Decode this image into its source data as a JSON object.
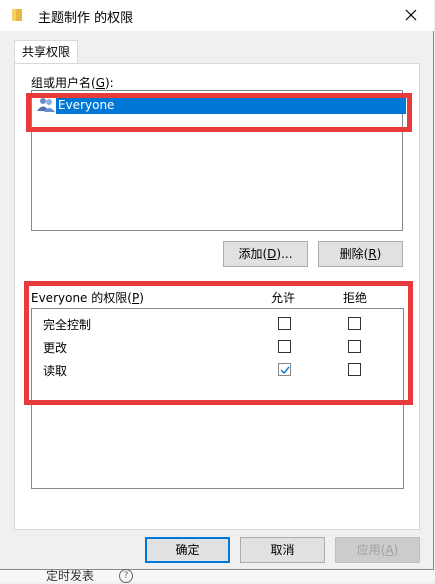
{
  "window": {
    "title": "主题制作 的权限",
    "close_icon": "close-icon",
    "folder_icon": "folder-icon"
  },
  "tab": {
    "label": "共享权限"
  },
  "users": {
    "label": "组或用户名(",
    "label_key": "G",
    "label_end": "):",
    "items": [
      {
        "name": "Everyone",
        "icon": "users-icon",
        "selected": true
      }
    ],
    "add_label": "添加(",
    "add_key": "D",
    "add_end": ")...",
    "remove_label": "删除(",
    "remove_key": "R",
    "remove_end": ")"
  },
  "permissions": {
    "label": "Everyone 的权限(",
    "label_key": "P",
    "label_end": ")",
    "allow_header": "允许",
    "deny_header": "拒绝",
    "rows": [
      {
        "name": "完全控制",
        "allow": false,
        "deny": false
      },
      {
        "name": "更改",
        "allow": false,
        "deny": false
      },
      {
        "name": "读取",
        "allow": true,
        "deny": false
      }
    ]
  },
  "footer": {
    "ok_label": "确定",
    "cancel_label": "取消",
    "apply_label": "应用(",
    "apply_key": "A",
    "apply_end": ")"
  },
  "background": {
    "partial_text": "定时发表"
  },
  "colors": {
    "highlight": "#e83a3a",
    "selection": "#0078d7"
  }
}
